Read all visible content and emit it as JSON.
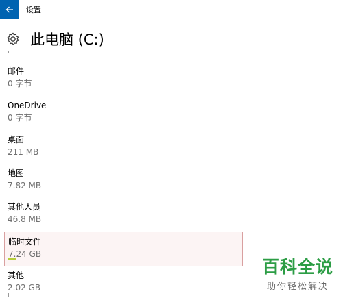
{
  "window": {
    "title": "设置"
  },
  "header": {
    "title": "此电脑 (C:)"
  },
  "items": [
    {
      "label": "邮件",
      "size": "0 字节"
    },
    {
      "label": "OneDrive",
      "size": "0 字节"
    },
    {
      "label": "桌面",
      "size": "211 MB"
    },
    {
      "label": "地图",
      "size": "7.82 MB"
    },
    {
      "label": "其他人员",
      "size": "46.8 MB"
    },
    {
      "label": "临时文件",
      "size": "7.24 GB"
    },
    {
      "label": "其他",
      "size": "2.02 GB"
    }
  ],
  "watermark": {
    "main": "百科全说",
    "sub": "助你轻松解决"
  },
  "colors": {
    "accent": "#0063b1",
    "usage_bar": "#b5cd3a",
    "selection_border": "#d9a0a0"
  },
  "icons": {
    "back": "back-arrow-icon",
    "settings": "gear-icon"
  }
}
